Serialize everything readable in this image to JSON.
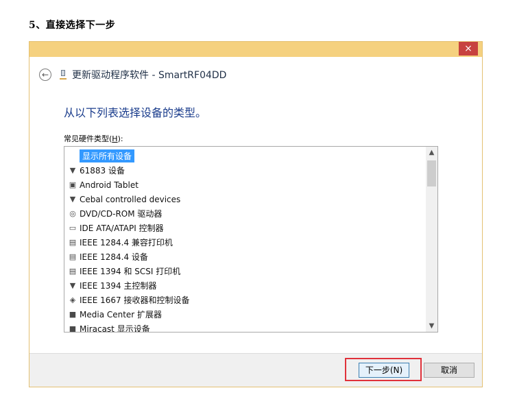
{
  "step_title": "5、直接选择下一步",
  "dialog": {
    "close_label": "×",
    "header_title": "更新驱动程序软件 - SmartRF04DD",
    "heading": "从以下列表选择设备的类型。",
    "list_label_prefix": "常见硬件类型(",
    "list_label_accel": "H",
    "list_label_suffix": "):",
    "items": [
      {
        "label": "显示所有设备",
        "icon": "none",
        "selected": true
      },
      {
        "label": "61883 设备",
        "icon": "plug-icon"
      },
      {
        "label": "Android Tablet",
        "icon": "tablet-icon"
      },
      {
        "label": "Cebal controlled devices",
        "icon": "plug-icon"
      },
      {
        "label": "DVD/CD-ROM 驱动器",
        "icon": "disc-drive-icon"
      },
      {
        "label": "IDE ATA/ATAPI 控制器",
        "icon": "ide-controller-icon"
      },
      {
        "label": "IEEE 1284.4 兼容打印机",
        "icon": "printer-icon"
      },
      {
        "label": "IEEE 1284.4 设备",
        "icon": "printer-icon"
      },
      {
        "label": "IEEE 1394 和 SCSI 打印机",
        "icon": "printer-icon"
      },
      {
        "label": "IEEE 1394 主控制器",
        "icon": "plug-icon"
      },
      {
        "label": "IEEE 1667 接收器和控制设备",
        "icon": "key-device-icon"
      },
      {
        "label": "Media Center 扩展器",
        "icon": "monitor-icon"
      },
      {
        "label": "Miracast 显示设备",
        "icon": "display-icon"
      }
    ],
    "next_label": "下一步(N)",
    "cancel_label": "取消"
  }
}
